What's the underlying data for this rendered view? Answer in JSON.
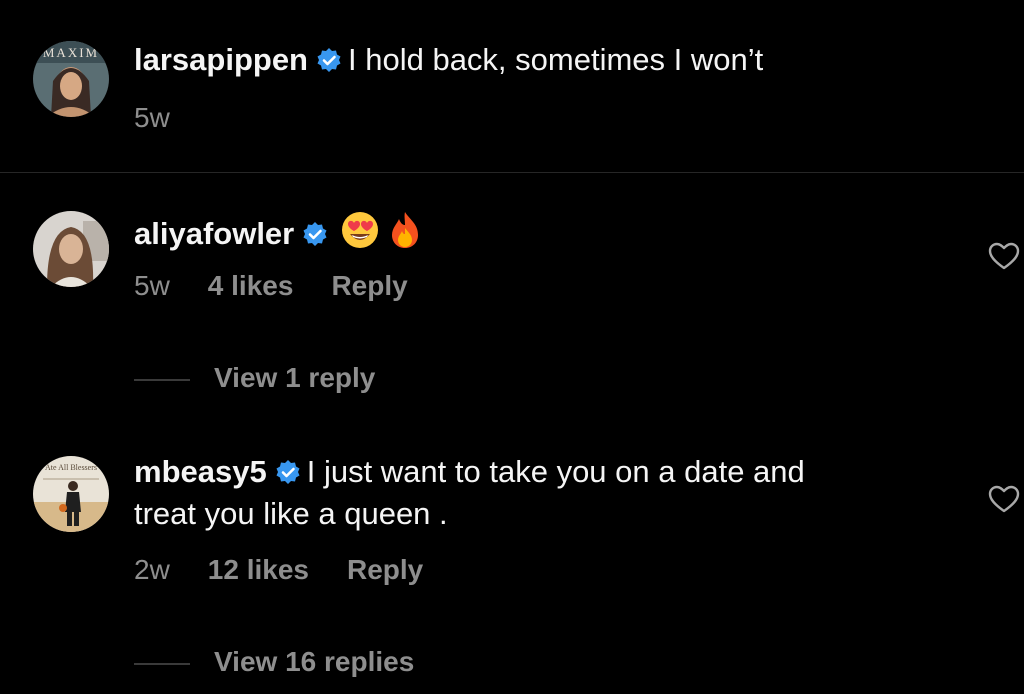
{
  "comments": [
    {
      "username": "larsapippen",
      "text": "I hold back, sometimes I won’t",
      "time": "5w",
      "avatar_icon": "magazine-cover-avatar",
      "verified": true
    },
    {
      "username": "aliyafowler",
      "text": "",
      "emojis": [
        "heart-eyes-emoji",
        "fire-emoji"
      ],
      "time": "5w",
      "likes": "4 likes",
      "reply_label": "Reply",
      "view_replies": "View 1 reply",
      "avatar_icon": "portrait-avatar",
      "verified": true
    },
    {
      "username": "mbeasy5",
      "text_line1": "I just want to take you on a date and",
      "text_line2": "treat you like a queen .",
      "time": "2w",
      "likes": "12 likes",
      "reply_label": "Reply",
      "view_replies": "View 16 replies",
      "avatar_text": "Ate All Blessers",
      "avatar_icon": "basketball-gym-avatar",
      "verified": true
    }
  ],
  "colors": {
    "background": "#000000",
    "text": "#f5f5f5",
    "muted": "#8e8e8e",
    "verified": "#3897f0"
  }
}
